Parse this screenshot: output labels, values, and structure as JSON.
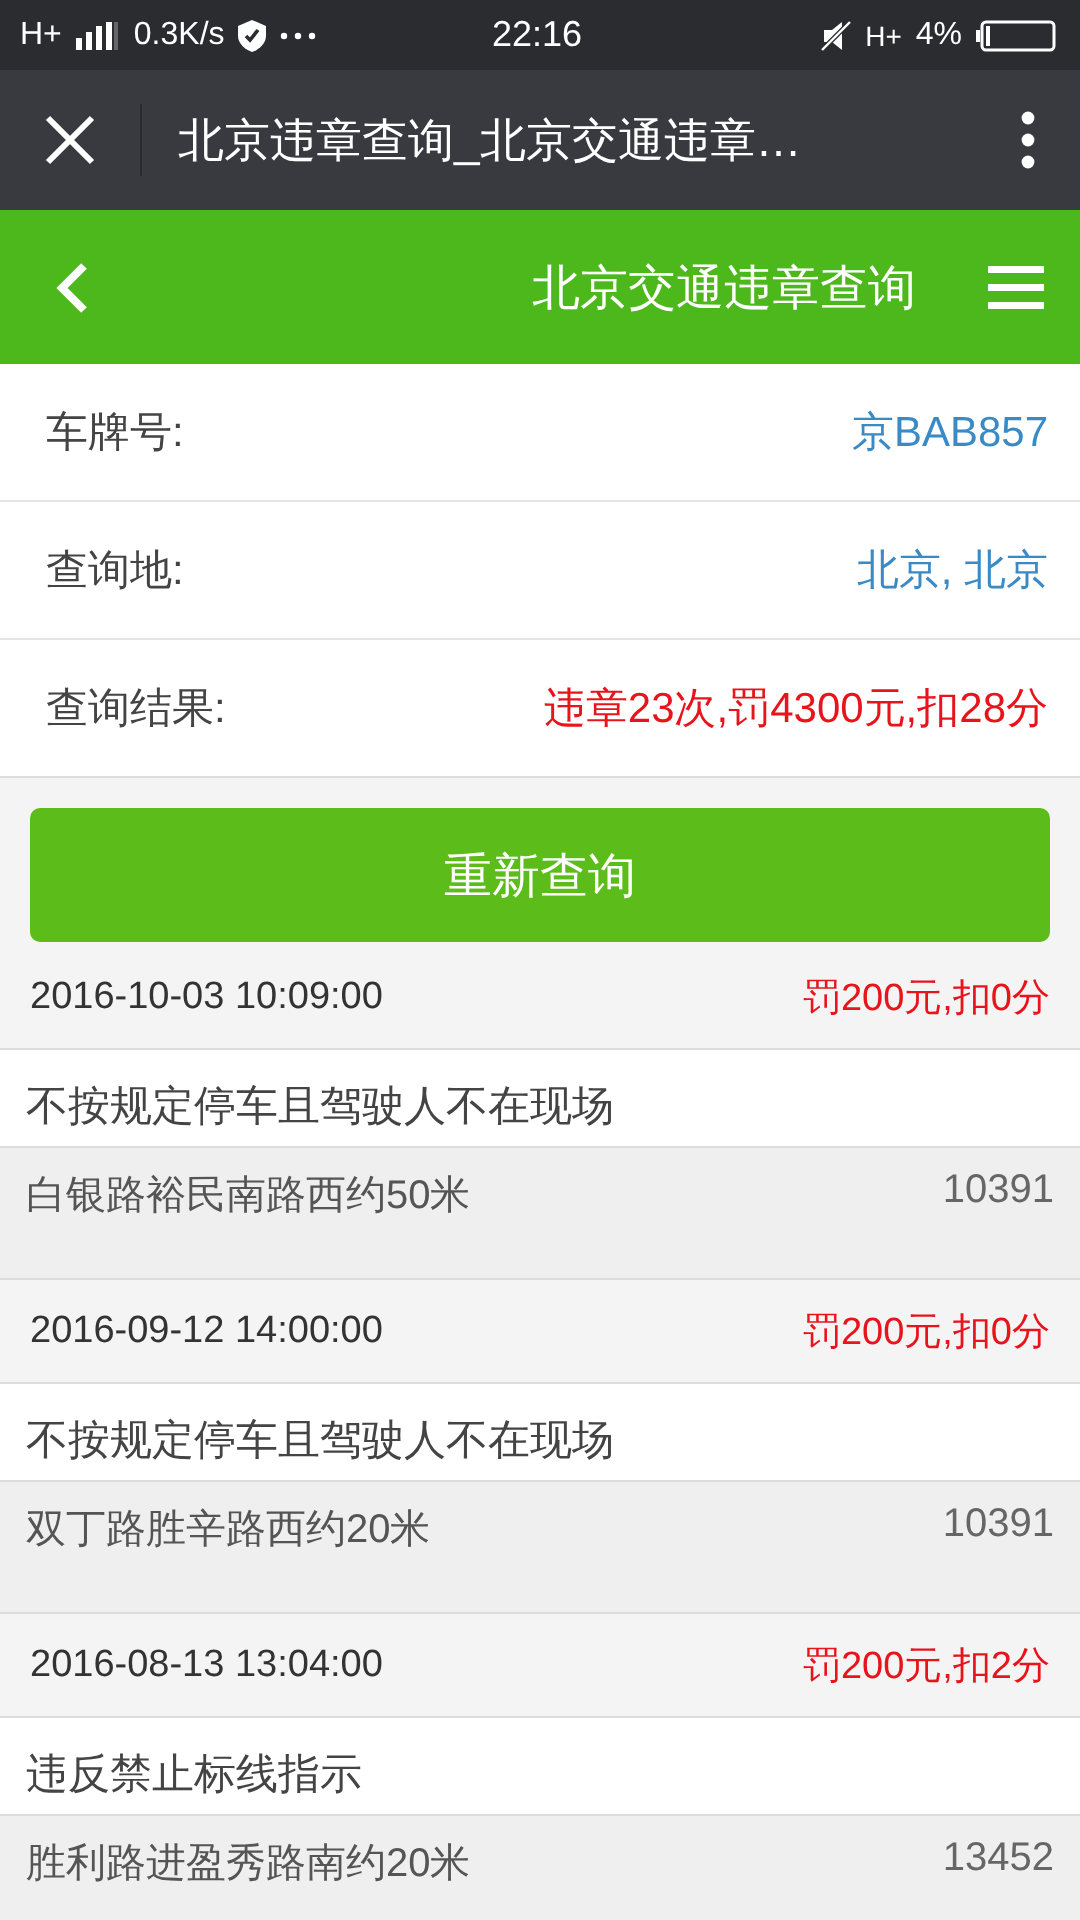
{
  "status_bar": {
    "network": "H+",
    "speed": "0.3K/s",
    "time": "22:16",
    "network_2": "H+",
    "battery": "4%"
  },
  "browser_bar": {
    "title": "北京违章查询_北京交通违章…"
  },
  "header": {
    "title": "北京交通违章查询"
  },
  "info": [
    {
      "label": "车牌号:",
      "value": "京BAB857",
      "kind": "link"
    },
    {
      "label": "查询地:",
      "value": "北京, 北京",
      "kind": "link"
    },
    {
      "label": "查询结果:",
      "value": "违章23次,罚4300元,扣28分",
      "kind": "alert"
    }
  ],
  "button": "重新查询",
  "records": [
    {
      "time": "2016-10-03 10:09:00",
      "penalty": "罚200元,扣0分",
      "description": "不按规定停车且驾驶人不在现场",
      "location": "白银路裕民南路西约50米",
      "code": "10391"
    },
    {
      "time": "2016-09-12 14:00:00",
      "penalty": "罚200元,扣0分",
      "description": "不按规定停车且驾驶人不在现场",
      "location": "双丁路胜辛路西约20米",
      "code": "10391"
    },
    {
      "time": "2016-08-13 13:04:00",
      "penalty": "罚200元,扣2分",
      "description": "违反禁止标线指示",
      "location": "胜利路进盈秀路南约20米",
      "code": "13452"
    }
  ]
}
